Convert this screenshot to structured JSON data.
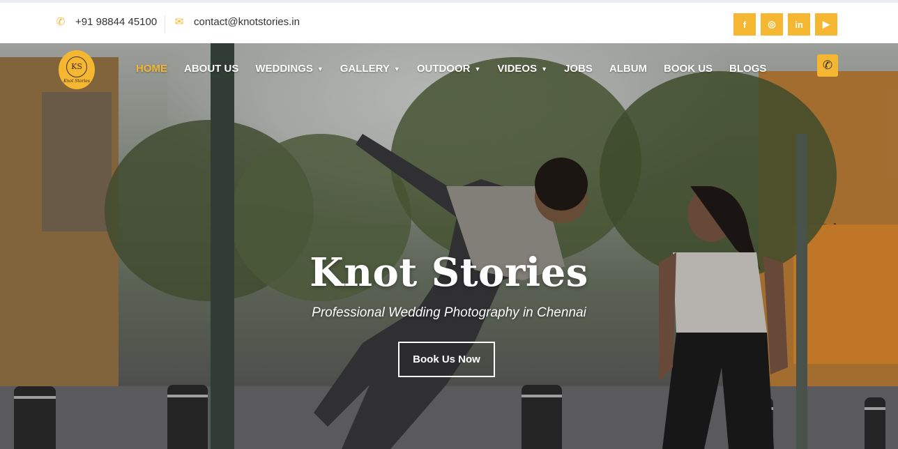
{
  "topbar": {
    "phone_icon": "phone-icon",
    "phone": "+91 98844 45100",
    "email_icon": "envelope-icon",
    "email": "contact@knotstories.in",
    "socials": [
      {
        "icon": "facebook-icon",
        "glyph": "f"
      },
      {
        "icon": "instagram-icon",
        "glyph": "◎"
      },
      {
        "icon": "linkedin-icon",
        "glyph": "in"
      },
      {
        "icon": "youtube-icon",
        "glyph": "▶"
      }
    ]
  },
  "brand": {
    "mark": "KS",
    "word": "Knot Stories"
  },
  "nav": {
    "items": [
      {
        "label": "HOME",
        "active": true,
        "dropdown": false
      },
      {
        "label": "ABOUT US",
        "active": false,
        "dropdown": false
      },
      {
        "label": "WEDDINGS",
        "active": false,
        "dropdown": true
      },
      {
        "label": "GALLERY",
        "active": false,
        "dropdown": true
      },
      {
        "label": "OUTDOOR",
        "active": false,
        "dropdown": true
      },
      {
        "label": "VIDEOS",
        "active": false,
        "dropdown": true
      },
      {
        "label": "JOBS",
        "active": false,
        "dropdown": false
      },
      {
        "label": "ALBUM",
        "active": false,
        "dropdown": false
      },
      {
        "label": "BOOK US",
        "active": false,
        "dropdown": false
      },
      {
        "label": "BLOGS",
        "active": false,
        "dropdown": false
      }
    ],
    "call_icon": "phone-icon"
  },
  "hero": {
    "title": "Knot Stories",
    "subtitle": "Professional Wedding Photography in Chennai",
    "cta": "Book Us Now"
  },
  "colors": {
    "accent": "#f5b731",
    "text_dark": "#333333",
    "white": "#ffffff"
  }
}
